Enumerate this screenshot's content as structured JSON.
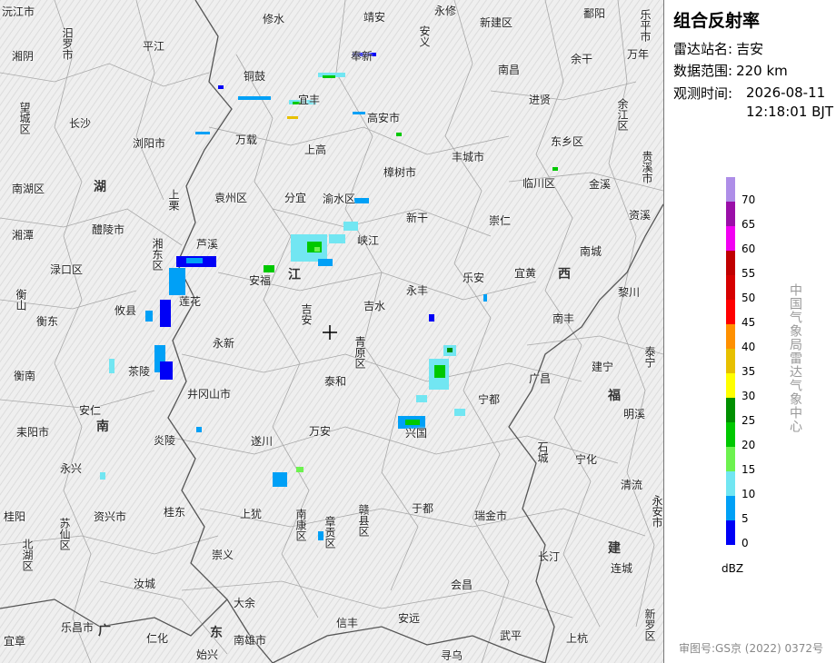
{
  "panel": {
    "title": "组合反射率",
    "station_label": "雷达站名:",
    "station": "吉安",
    "range_label": "数据范围:",
    "range": "220 km",
    "time_label": "观测时间:",
    "date": "2026-08-11",
    "time": "12:18:01 BJT",
    "unit": "dBZ",
    "agency": "中国气象局雷达气象中心",
    "map_number": "审图号:GS京 (2022) 0372号"
  },
  "legend": [
    {
      "label": "70",
      "color": "#ae8ee8"
    },
    {
      "label": "65",
      "color": "#9a0fa8"
    },
    {
      "label": "60",
      "color": "#f200f2"
    },
    {
      "label": "55",
      "color": "#c00000"
    },
    {
      "label": "50",
      "color": "#d60000"
    },
    {
      "label": "45",
      "color": "#ff0000"
    },
    {
      "label": "40",
      "color": "#ff9000"
    },
    {
      "label": "35",
      "color": "#e7c000"
    },
    {
      "label": "30",
      "color": "#ffff00"
    },
    {
      "label": "25",
      "color": "#008f00"
    },
    {
      "label": "20",
      "color": "#00c800"
    },
    {
      "label": "15",
      "color": "#6df24f"
    },
    {
      "label": "10",
      "color": "#72e6f2"
    },
    {
      "label": "5",
      "color": "#00a0f6"
    },
    {
      "label": "0",
      "color": "#0000f6"
    }
  ],
  "places": {
    "p1": "沅江市",
    "p2": "汨罗市",
    "p3": "平江",
    "p4": "修水",
    "p5": "靖安",
    "p6": "永修",
    "p7": "新建区",
    "p8": "鄱阳",
    "p9": "乐平市",
    "p10": "湘阴",
    "p11": "铜鼓",
    "p12": "奉新",
    "p13": "安义",
    "p14": "南昌",
    "p15": "余干",
    "p16": "万年",
    "p17": "望城区",
    "p18": "长沙",
    "p19": "宜丰",
    "p20": "高安市",
    "p21": "进贤",
    "p22": "余江区",
    "p23": "浏阳市",
    "p24": "万载",
    "p25": "上高",
    "p26": "丰城市",
    "p27": "东乡区",
    "p28": "贵溪市",
    "p29": "南湖区",
    "p30": "樟树市",
    "p31": "临川区",
    "p32": "金溪",
    "p33": "上栗",
    "p34": "袁州区",
    "p35": "分宜",
    "p36": "渝水区",
    "p37": "资溪",
    "p38": "湘潭",
    "p39": "醴陵市",
    "p40": "新干",
    "p41": "崇仁",
    "p42": "南城",
    "p43": "湘东区",
    "p44": "芦溪",
    "p45": "峡江",
    "p46": "渌口区",
    "p47": "安福",
    "p48": "乐安",
    "p49": "宜黄",
    "p50": "黎川",
    "p51": "衡山",
    "p52": "攸县",
    "p53": "莲花",
    "p54": "吉安",
    "p55": "吉水",
    "p56": "永丰",
    "p57": "南丰",
    "p58": "衡东",
    "p59": "永新",
    "p60": "青原区",
    "p61": "泰宁",
    "p62": "衡南",
    "p63": "茶陵",
    "p64": "泰和",
    "p65": "广昌",
    "p66": "建宁",
    "p67": "井冈山市",
    "p68": "宁都",
    "p69": "安仁",
    "p70": "明溪",
    "p71": "耒阳市",
    "p72": "炎陵",
    "p73": "万安",
    "p74": "兴国",
    "p75": "石城",
    "p76": "宁化",
    "p77": "遂川",
    "p78": "永兴",
    "p79": "清流",
    "p80": "于都",
    "p81": "桂阳",
    "p82": "资兴市",
    "p83": "桂东",
    "p84": "上犹",
    "p85": "南康区",
    "p86": "章贡区",
    "p87": "赣县区",
    "p88": "瑞金市",
    "p89": "永安市",
    "p90": "苏仙区",
    "p91": "北湖区",
    "p92": "崇义",
    "p93": "长汀",
    "p94": "连城",
    "p95": "汝城",
    "p96": "会昌",
    "p97": "大余",
    "p98": "信丰",
    "p99": "宜章",
    "p100": "乐昌市",
    "p101": "仁化",
    "p102": "南雄市",
    "p103": "安远",
    "p104": "武平",
    "p105": "上杭",
    "p106": "新罗区",
    "p107": "始兴",
    "p108": "寻乌"
  },
  "provinces": {
    "hu": "湖",
    "nan": "南",
    "jiang": "江",
    "xi": "西",
    "fu": "福",
    "jian": "建",
    "guang": "广",
    "dong": "东"
  }
}
